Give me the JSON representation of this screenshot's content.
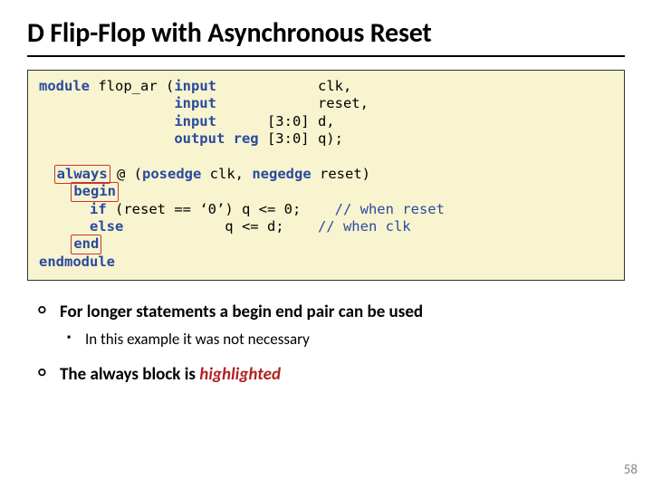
{
  "title": "D Flip-Flop with Asynchronous Reset",
  "code": {
    "l1a": "module",
    "l1b": " flop_ar (",
    "l1c": "input",
    "l1d": "            clk,",
    "l2a": "                ",
    "l2b": "input",
    "l2c": "            reset,",
    "l3a": "                ",
    "l3b": "input",
    "l3c": "      [3:0] d,",
    "l4a": "                ",
    "l4b": "output reg",
    "l4c": " [3:0] q);",
    "l5a": "  ",
    "l5b": "always",
    "l5c": " @ (",
    "l5d": "posedge",
    "l5e": " clk, ",
    "l5f": "negedge",
    "l5g": " reset)",
    "l6a": "    ",
    "l6b": "begin",
    "l7a": "      ",
    "l7b": "if",
    "l7c": " (reset == ‘0’) q <= 0;    ",
    "l7d": "// when reset",
    "l8a": "      ",
    "l8b": "else",
    "l8c": "            q <= d;    ",
    "l8d": "// when clk",
    "l9a": "    ",
    "l9b": "end",
    "l10": "endmodule"
  },
  "bullets": {
    "b1": "For longer statements a begin end pair can be used",
    "b1a": "In this example it was not necessary",
    "b2_pre": "The always block is ",
    "b2_em": "highlighted"
  },
  "page": "58"
}
